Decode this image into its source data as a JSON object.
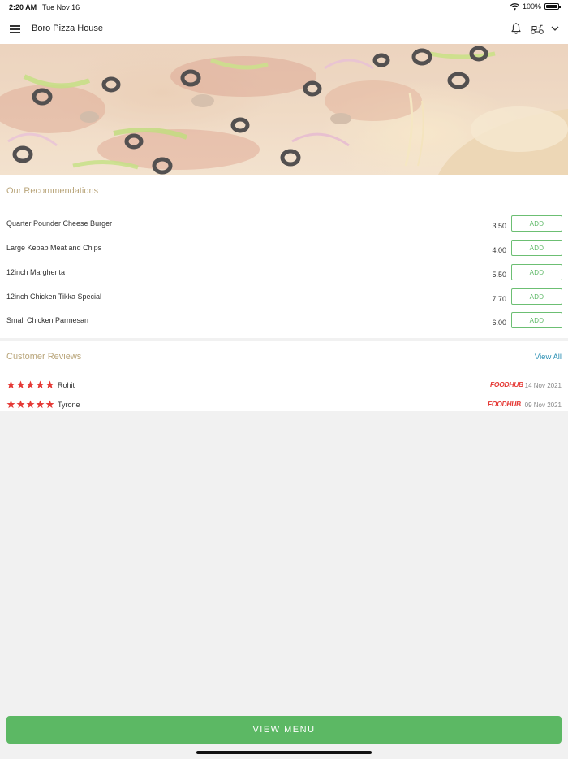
{
  "status_bar": {
    "time": "2:20 AM",
    "date": "Tue Nov 16",
    "battery": "100%"
  },
  "header": {
    "title": "Boro Pizza House"
  },
  "icons": {
    "menu": "hamburger-menu-icon",
    "notifications": "bell-icon",
    "delivery": "scooter-icon",
    "dropdown": "chevron-down-icon",
    "rating": "star-icon"
  },
  "colors": {
    "accent_green": "#5cb864",
    "section_title": "#b9a57a",
    "link_blue": "#2a8fb3",
    "star_red": "#e53935",
    "foodhub_red": "#e53935"
  },
  "recommendations": {
    "title": "Our Recommendations",
    "add_label": "ADD",
    "items": [
      {
        "name": "Quarter Pounder Cheese Burger",
        "price": "3.50"
      },
      {
        "name": "Large Kebab Meat and Chips",
        "price": "4.00"
      },
      {
        "name": "12inch Margherita",
        "price": "5.50"
      },
      {
        "name": "12inch Chicken Tikka Special",
        "price": "7.70"
      },
      {
        "name": "Small Chicken Parmesan",
        "price": "6.00"
      }
    ]
  },
  "reviews": {
    "title": "Customer Reviews",
    "view_all": "View All",
    "source_label": "FOODHUB",
    "items": [
      {
        "name": "Rohit",
        "rating": 5,
        "date": "14 Nov 2021"
      },
      {
        "name": "Tyrone",
        "rating": 5,
        "date": "09 Nov 2021"
      }
    ]
  },
  "footer": {
    "view_menu": "VIEW MENU"
  }
}
